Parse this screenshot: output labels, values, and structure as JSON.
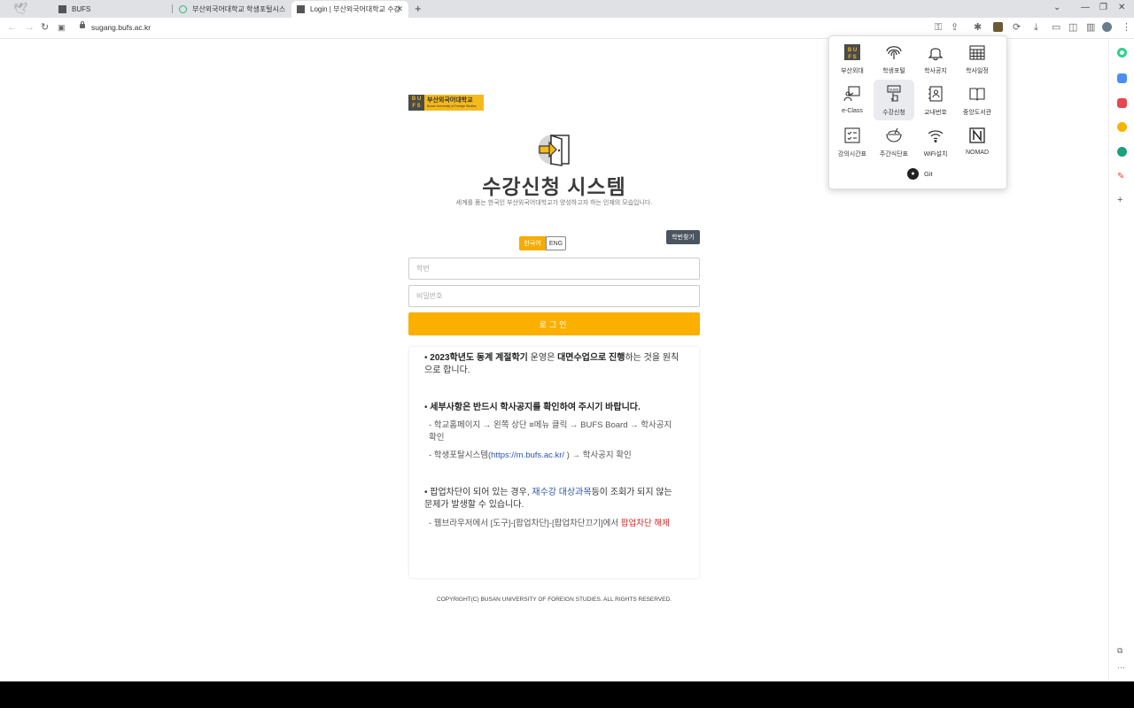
{
  "browser": {
    "tabs": [
      {
        "title": "BUFS"
      },
      {
        "title": "부산외국어대학교 학생포털시스"
      },
      {
        "title": "Login | 부산외국어대학교 수강"
      }
    ],
    "new_tab_label": "+",
    "url": "sugang.bufs.ac.kr"
  },
  "extension_menu": {
    "items": [
      {
        "label": "부산외대",
        "icon": "bufs-logo-icon"
      },
      {
        "label": "학생포털",
        "icon": "fingerprint-icon"
      },
      {
        "label": "학사공지",
        "icon": "bell-icon"
      },
      {
        "label": "학사일정",
        "icon": "calendar-icon"
      },
      {
        "label": "e-Class",
        "icon": "teacher-board-icon"
      },
      {
        "label": "수강신청",
        "icon": "enroll-click-icon"
      },
      {
        "label": "교내번호",
        "icon": "contact-book-icon"
      },
      {
        "label": "중앙도서관",
        "icon": "book-icon"
      },
      {
        "label": "강의시간표",
        "icon": "checklist-icon"
      },
      {
        "label": "주간식단표",
        "icon": "bowl-icon"
      },
      {
        "label": "WiFi설치",
        "icon": "wifi-icon"
      },
      {
        "label": "NOMAD",
        "icon": "notion-icon"
      }
    ],
    "git_label": "Git"
  },
  "page": {
    "logo": {
      "block_top": "B U",
      "block_bottom": "F S",
      "name": "부산외국어대학교",
      "name_en": "Busan University of Foreign Studies"
    },
    "title": "수강신청 시스템",
    "subtitle": "세계를 품는 한국인 부산외국어대학교가 양성하고자 하는 인재의 모습입니다.",
    "find_button": "학번찾기",
    "lang_ko": "한국어",
    "lang_en": "ENG",
    "student_id_placeholder": "학번",
    "password_placeholder": "비밀번호",
    "login_button": "로그인",
    "notice": {
      "p1_bold1": "2023학년도 동계 계절학기",
      "p1_text1": " 운영은 ",
      "p1_bold2": "대면수업으로 진행",
      "p1_text2": "하는 것을 원칙으로 합니다.",
      "p2": "세부사항은 반드시 학사공지를 확인하여 주시기 바랍니다.",
      "p2_sub1": "- 학교홈페이지 → 왼쪽 상단 ≡메뉴 클릭 → BUFS Board → 학사공지 확인",
      "p2_sub2_a": "- 학생포탈시스템(",
      "p2_sub2_link": "https://m.bufs.ac.kr/",
      "p2_sub2_b": "   ) → 학사공지 확인",
      "p3_a": "팝업차단이 되어 있는 경우, ",
      "p3_link": "재수강 대상과목",
      "p3_b": "등이 조회가 되지 않는 문제가 발생할 수 있습니다.",
      "p3_sub_a": "- 웹브라우저에서 [도구]-[팝업차단]-[팝업차단끄기]에서 ",
      "p3_sub_red": "팝업차단 해제"
    },
    "copyright": "COPYRIGHT(C) BUSAN UNIVERSITY OF FOREIGN STUDIES. ALL RIGHTS RESERVED."
  },
  "colors": {
    "accent": "#fbb000",
    "brand_yellow": "#f4b91b",
    "find_button": "#4b5560",
    "link_blue": "#2a55b0",
    "warn_red": "#d32222"
  }
}
